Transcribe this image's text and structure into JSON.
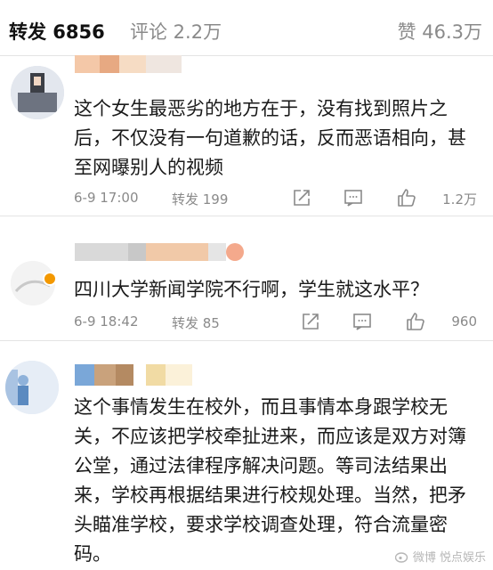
{
  "tabs": {
    "repost": "转发 6856",
    "comment": "评论 2.2万",
    "like": "赞 46.3万"
  },
  "comments": [
    {
      "text": "这个女生最恶劣的地方在于，没有找到照片之后，不仅没有一句道歉的话，反而恶语相向，甚至网曝别人的视频",
      "time": "6-9 17:00",
      "repost": "转发 199",
      "likes": "1.2万"
    },
    {
      "text": "四川大学新闻学院不行啊，学生就这水平？",
      "time": "6-9 18:42",
      "repost": "转发 85",
      "likes": "960"
    },
    {
      "text": "这个事情发生在校外，而且事情本身跟学校无关，不应该把学校牵扯进来，而应该是双方对簿公堂，通过法律程序解决问题。等司法结果出来，学校再根据结果进行校规处理。当然，把矛头瞄准学校，要求学校调查处理，符合流量密码。"
    }
  ],
  "watermark": "微博 悦点娱乐",
  "colors": {
    "text": "#1a1a1a",
    "muted": "#8a8a8a",
    "badge": "#f39800"
  }
}
